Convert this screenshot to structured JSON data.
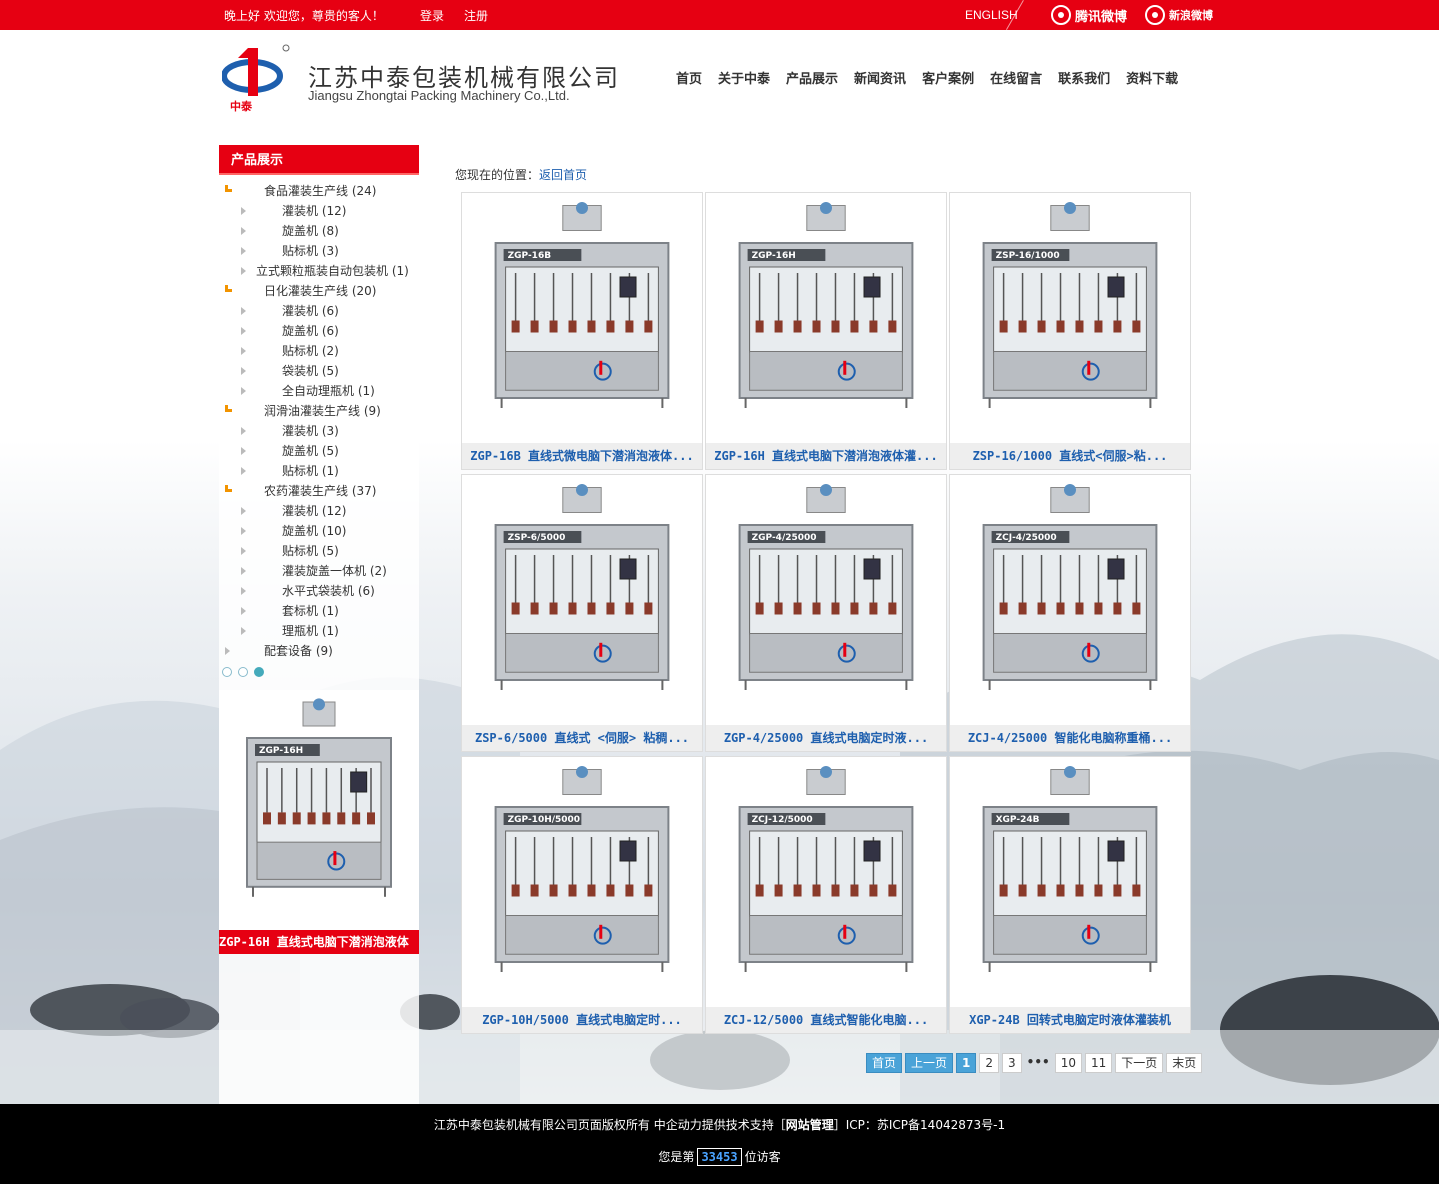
{
  "topbar": {
    "greeting": "晚上好  欢迎您，尊贵的客人！",
    "login": "登录",
    "register": "注册",
    "english": "ENGLISH",
    "tencent_weibo": "腾讯微博",
    "sina_weibo": "新浪微博"
  },
  "header": {
    "company_cn": "江苏中泰包装机械有限公司",
    "company_en": "Jiangsu Zhongtai Packing Machinery Co.,Ltd.",
    "logo_text": "中泰"
  },
  "nav": [
    "首页",
    "关于中泰",
    "产品展示",
    "新闻资讯",
    "客户案例",
    "在线留言",
    "联系我们",
    "资料下载"
  ],
  "sidebar": {
    "title": "产品展示",
    "items": [
      {
        "level": 1,
        "label": "食品灌装生产线 (24)"
      },
      {
        "level": 2,
        "label": "灌装机 (12)"
      },
      {
        "level": 2,
        "label": "旋盖机 (8)"
      },
      {
        "level": 2,
        "label": "贴标机 (3)"
      },
      {
        "level": 0,
        "label": "立式颗粒瓶装自动包装机 (1)"
      },
      {
        "level": 1,
        "label": "日化灌装生产线 (20)"
      },
      {
        "level": 2,
        "label": "灌装机 (6)"
      },
      {
        "level": 2,
        "label": "旋盖机 (6)"
      },
      {
        "level": 2,
        "label": "贴标机 (2)"
      },
      {
        "level": 2,
        "label": "袋装机 (5)"
      },
      {
        "level": 2,
        "label": "全自动理瓶机 (1)"
      },
      {
        "level": 1,
        "label": "润滑油灌装生产线 (9)"
      },
      {
        "level": 2,
        "label": "灌装机 (3)"
      },
      {
        "level": 2,
        "label": "旋盖机 (5)"
      },
      {
        "level": 2,
        "label": "贴标机 (1)"
      },
      {
        "level": 1,
        "label": "农药灌装生产线 (37)"
      },
      {
        "level": 2,
        "label": "灌装机 (12)"
      },
      {
        "level": 2,
        "label": "旋盖机 (10)"
      },
      {
        "level": 2,
        "label": "贴标机 (5)"
      },
      {
        "level": 2,
        "label": "灌装旋盖一体机 (2)"
      },
      {
        "level": 2,
        "label": "水平式袋装机 (6)"
      },
      {
        "level": 2,
        "label": "套标机 (1)"
      },
      {
        "level": 2,
        "label": "理瓶机 (1)"
      },
      {
        "level": 3,
        "label": "配套设备 (9)"
      }
    ],
    "featured_caption": "ZGP-16H 直线式电脑下潜消泡液体",
    "featured_model": "ZGP-16H"
  },
  "breadcrumb": {
    "prefix": "您现在的位置：",
    "link": "返回首页"
  },
  "products": [
    {
      "model": "ZGP-16B",
      "caption": "ZGP-16B 直线式微电脑下潜消泡液体..."
    },
    {
      "model": "ZGP-16H",
      "caption": "ZGP-16H 直线式电脑下潜消泡液体灌..."
    },
    {
      "model": "ZSP-16/1000",
      "caption": "ZSP-16/1000 直线式<伺服>粘..."
    },
    {
      "model": "ZSP-6/5000",
      "caption": "ZSP-6/5000 直线式 <伺服> 粘稠..."
    },
    {
      "model": "ZGP-4/25000",
      "caption": "ZGP-4/25000 直线式电脑定时液..."
    },
    {
      "model": "ZCJ-4/25000",
      "caption": "ZCJ-4/25000 智能化电脑称重桶..."
    },
    {
      "model": "ZGP-10H/5000",
      "caption": "ZGP-10H/5000 直线式电脑定时..."
    },
    {
      "model": "ZCJ-12/5000",
      "caption": "ZCJ-12/5000 直线式智能化电脑..."
    },
    {
      "model": "XGP-24B",
      "caption": "XGP-24B 回转式电脑定时液体灌装机"
    }
  ],
  "pager": {
    "first": "首页",
    "prev": "上一页",
    "pages": [
      "1",
      "2",
      "3"
    ],
    "ellipsis": "•••",
    "tail_pages": [
      "10",
      "11"
    ],
    "next": "下一页",
    "last": "末页"
  },
  "footer": {
    "line1_a": "江苏中泰包装机械有限公司页面版权所有 中企动力提供技术支持［",
    "admin": "网站管理",
    "line1_b": "］ICP：苏ICP备14042873号-1",
    "visitor_prefix": "您是第",
    "visitor_count": "33453",
    "visitor_suffix": "位访客"
  },
  "colors": {
    "brand_red": "#e60012",
    "link_blue": "#1e5fae",
    "pager_blue": "#4aa3d8"
  }
}
